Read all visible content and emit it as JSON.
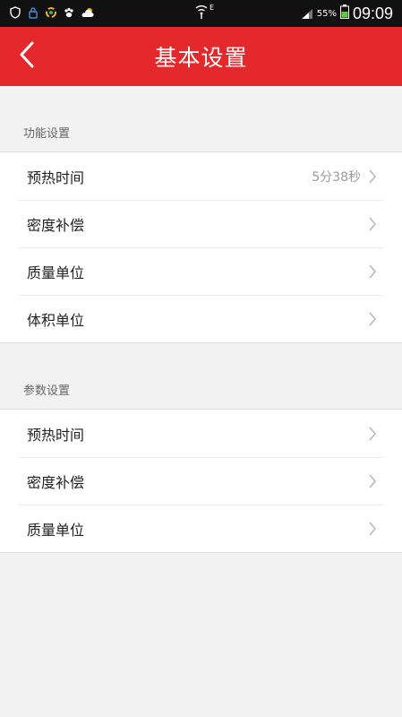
{
  "status_bar": {
    "battery_percent": "55%",
    "time": "09:09",
    "network": "E"
  },
  "header": {
    "title": "基本设置"
  },
  "sections": [
    {
      "title": "功能设置",
      "items": [
        {
          "label": "预热时间",
          "value": "5分38秒"
        },
        {
          "label": "密度补偿"
        },
        {
          "label": "质量单位"
        },
        {
          "label": "体积单位"
        }
      ]
    },
    {
      "title": "参数设置",
      "items": [
        {
          "label": "预热时间"
        },
        {
          "label": "密度补偿"
        },
        {
          "label": "质量单位"
        }
      ]
    }
  ],
  "colors": {
    "accent": "#e5282b",
    "status_bar_bg": "#111111",
    "page_bg": "#f2f2f2"
  }
}
